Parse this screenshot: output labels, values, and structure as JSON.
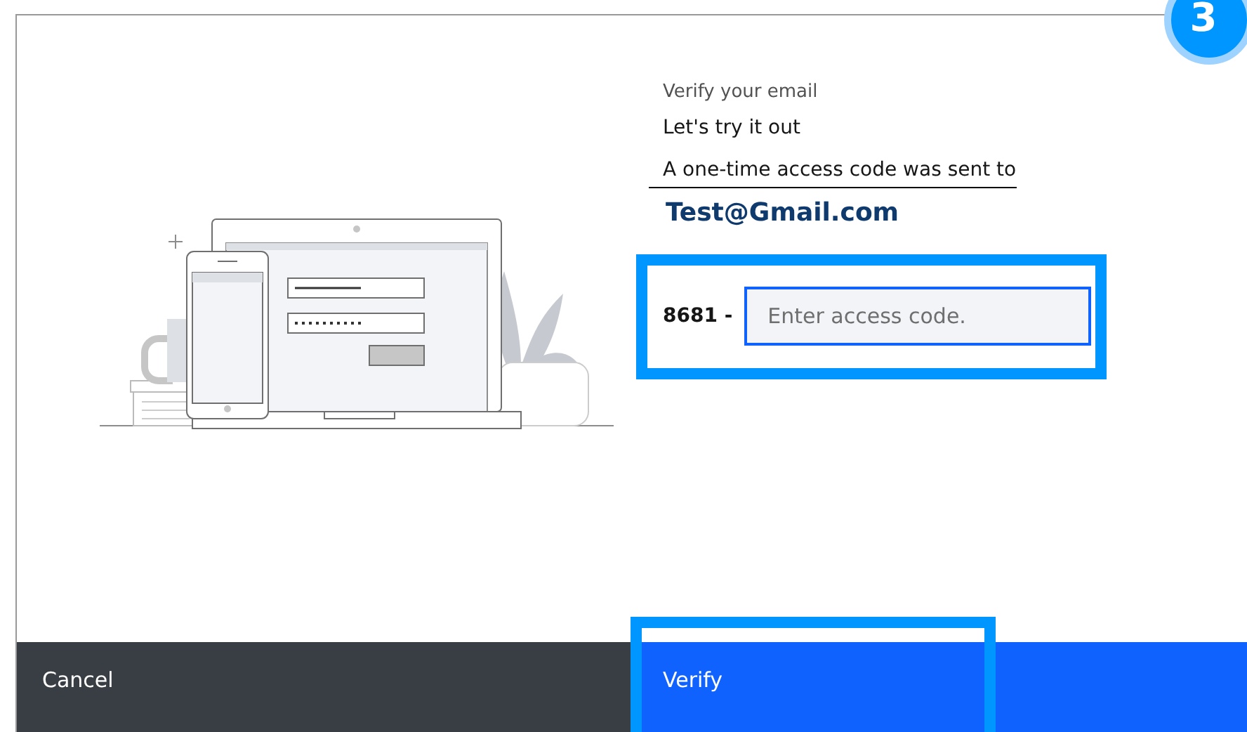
{
  "step_badge": "3",
  "heading": "Verify your email",
  "subheading": "Let's try it out",
  "message": "A one-time access code was sent to",
  "email": "Test@Gmail.com",
  "code_prefix": "8681 -",
  "code_input": {
    "placeholder": "Enter access code.",
    "focused": true
  },
  "buttons": [
    {
      "label": "Cancel",
      "kind": "secondary"
    },
    {
      "label": "Verify",
      "kind": "primary"
    }
  ]
}
